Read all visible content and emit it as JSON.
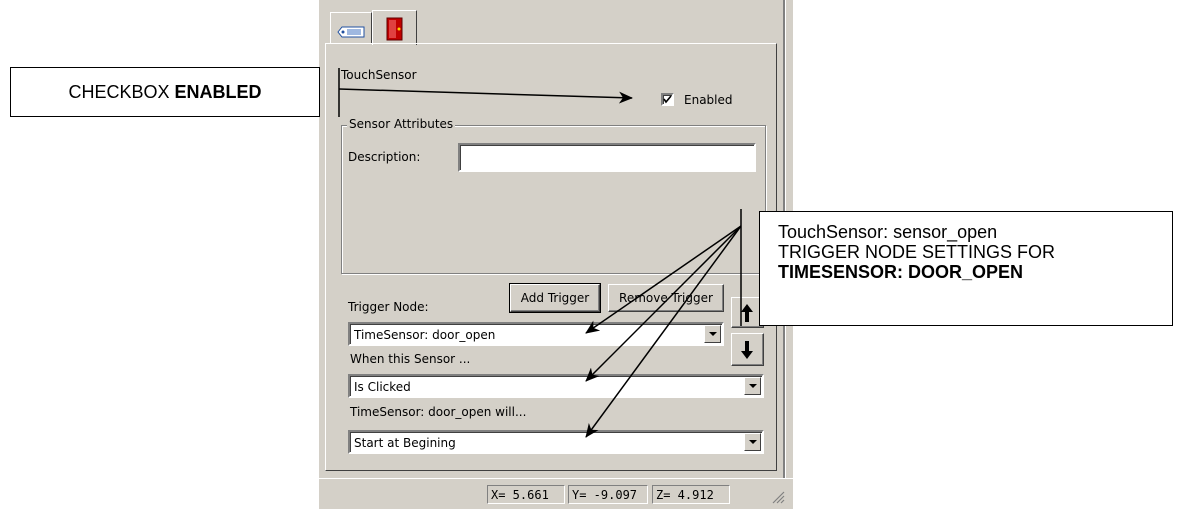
{
  "callouts": {
    "checkbox": {
      "text": "CHECKBOX ",
      "bold": "ENABLED"
    },
    "trigger": {
      "line1": "TouchSensor: sensor_open",
      "line2": "TRIGGER NODE SETTINGS FOR",
      "line3": "TIMESENSOR: DOOR_OPEN"
    }
  },
  "tabs": [
    {
      "icon": "tag-icon",
      "selected": false
    },
    {
      "icon": "door-icon",
      "selected": true
    }
  ],
  "node": {
    "title": "TouchSensor",
    "enabled_label": "Enabled",
    "enabled_checked": true
  },
  "sensor_attributes": {
    "group_label": "Sensor Attributes",
    "description_label": "Description:",
    "description_value": ""
  },
  "trigger": {
    "label": "Trigger Node:",
    "add_button": "Add Trigger",
    "remove_button": "Remove Trigger",
    "node_value": "TimeSensor:  door_open",
    "when_label": "When this Sensor ...",
    "when_value": "Is Clicked",
    "will_label": "TimeSensor:  door_open will...",
    "will_value": "Start at Begining"
  },
  "status": {
    "x": "X= 5.661",
    "y": "Y= -9.097",
    "z": "Z= 4.912"
  }
}
